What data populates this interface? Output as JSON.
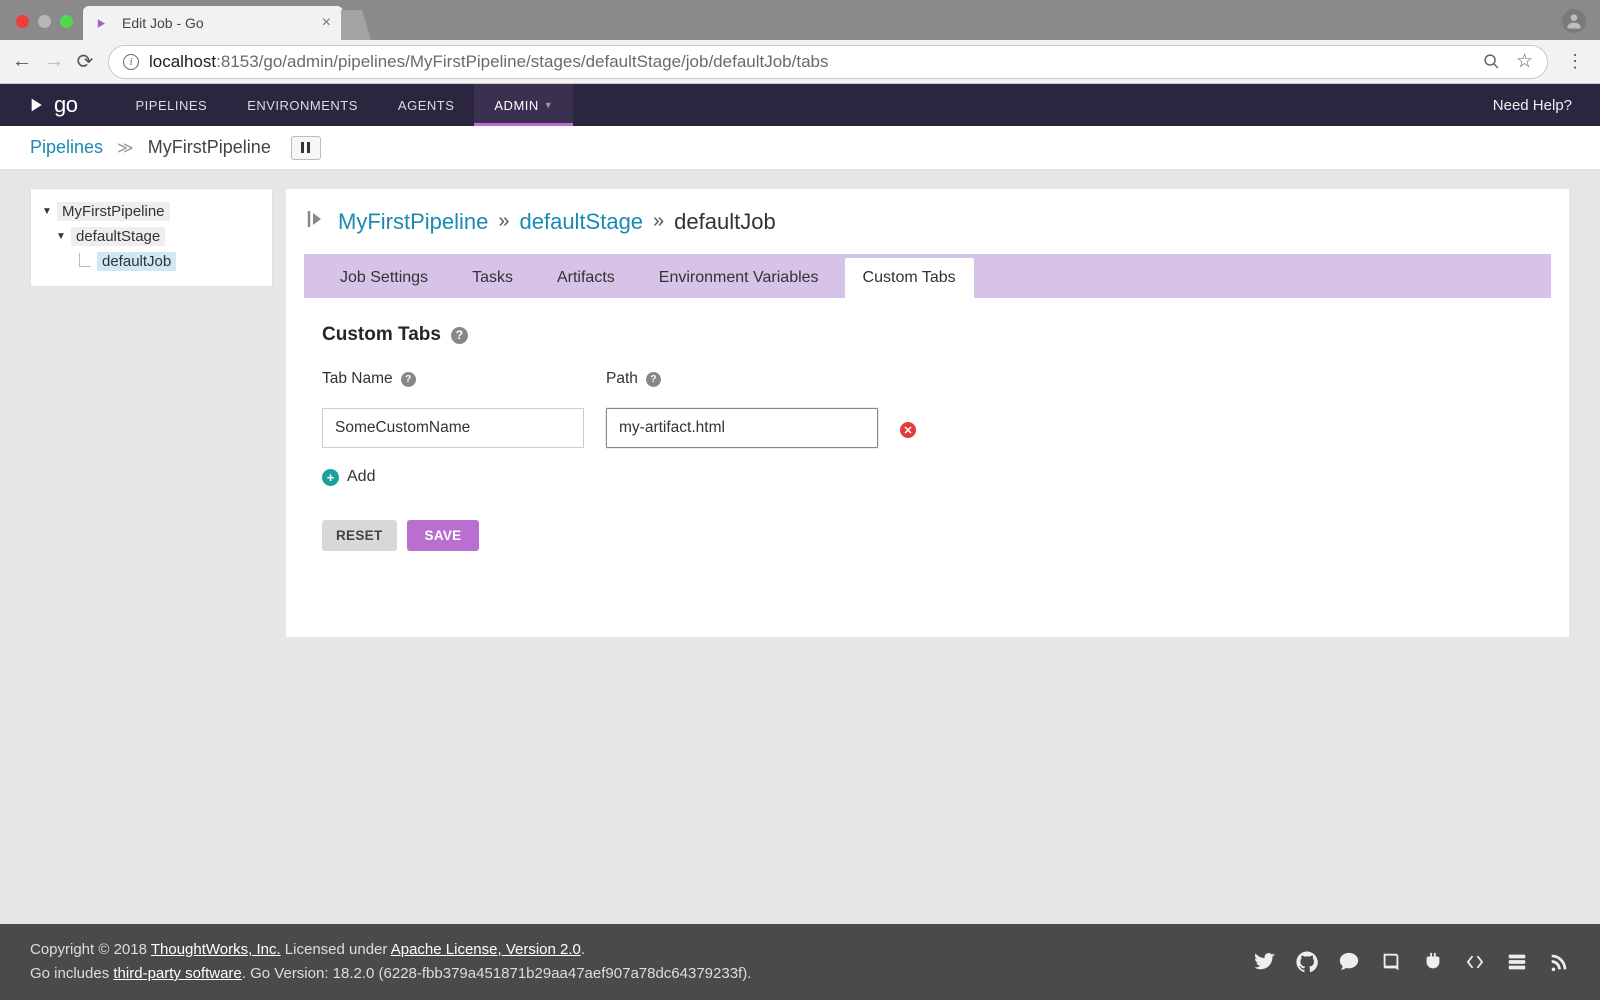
{
  "browser": {
    "tab_title": "Edit Job - Go",
    "url_host": "localhost",
    "url_rest": ":8153/go/admin/pipelines/MyFirstPipeline/stages/defaultStage/job/defaultJob/tabs"
  },
  "app_nav": {
    "pipelines": "PIPELINES",
    "environments": "ENVIRONMENTS",
    "agents": "AGENTS",
    "admin": "ADMIN",
    "help": "Need Help?"
  },
  "crumb": {
    "root": "Pipelines",
    "current": "MyFirstPipeline"
  },
  "tree": {
    "pipeline": "MyFirstPipeline",
    "stage": "defaultStage",
    "job": "defaultJob"
  },
  "pipeline_crumb": {
    "pipeline": "MyFirstPipeline",
    "stage": "defaultStage",
    "job": "defaultJob",
    "sep": "»"
  },
  "tabs": {
    "job_settings": "Job Settings",
    "tasks": "Tasks",
    "artifacts": "Artifacts",
    "env_vars": "Environment Variables",
    "custom_tabs": "Custom Tabs"
  },
  "section": {
    "title": "Custom Tabs",
    "col_name": "Tab Name",
    "col_path": "Path"
  },
  "row": {
    "name": "SomeCustomName",
    "path": "my-artifact.html"
  },
  "buttons": {
    "add": "Add",
    "reset": "RESET",
    "save": "SAVE"
  },
  "footer": {
    "line1_a": "Copyright © 2018 ",
    "line1_link1": "ThoughtWorks, Inc.",
    "line1_b": " Licensed under ",
    "line1_link2": "Apache License, Version 2.0",
    "line1_c": ".",
    "line2_a": "Go includes ",
    "line2_link": "third-party software",
    "line2_b": ". Go Version: 18.2.0 (6228-fbb379a451871b29aa47aef907a78dc64379233f)."
  }
}
